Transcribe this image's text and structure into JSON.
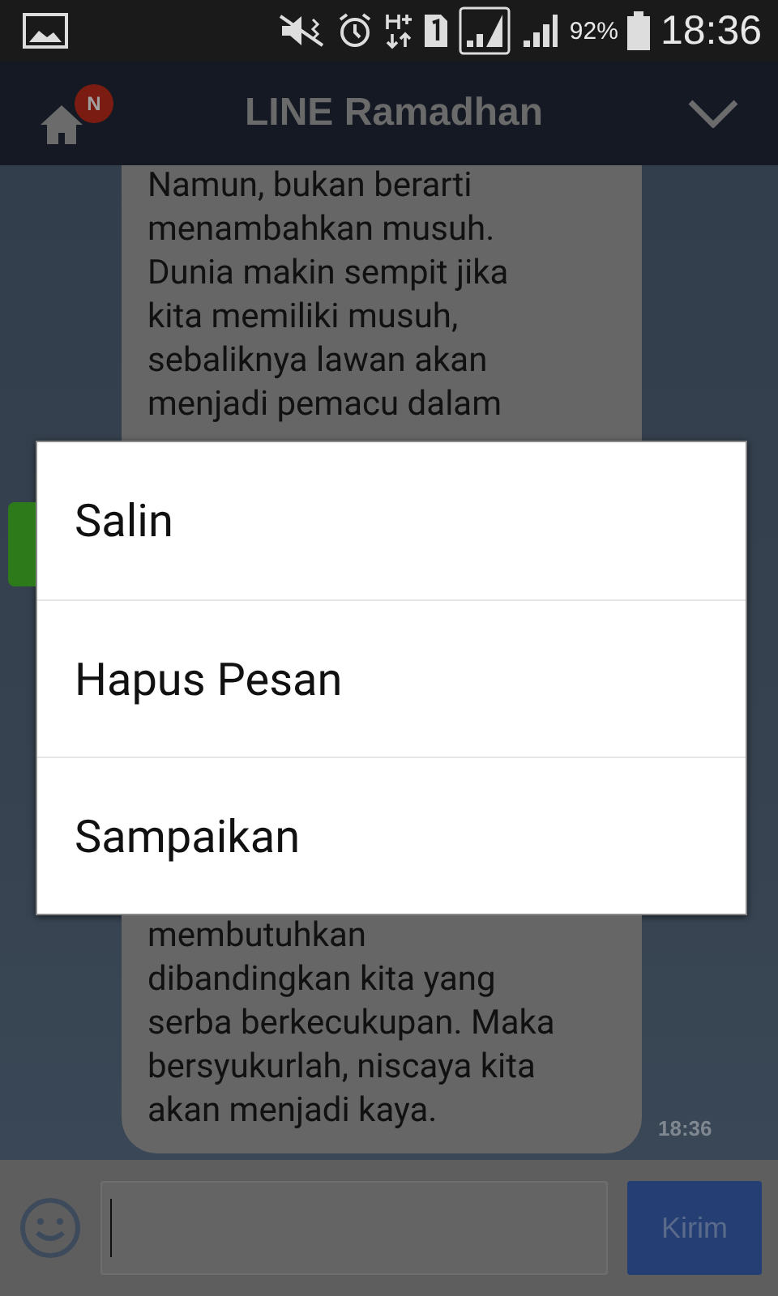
{
  "status_bar": {
    "battery": "92%",
    "time": "18:36"
  },
  "header": {
    "title": "LINE Ramadhan",
    "badge": "N"
  },
  "message": {
    "lines_above": [
      "Namun, bukan berarti",
      "menambahkan musuh.",
      "Dunia makin sempit jika",
      "kita memiliki musuh,",
      "sebaliknya lawan akan",
      "menjadi pemacu dalam"
    ],
    "lines_below": [
      "membutuhkan",
      "dibandingkan kita yang",
      "serba berkecukupan. Maka",
      "bersyukurlah, niscaya kita",
      "akan menjadi kaya."
    ],
    "time": "18:36"
  },
  "menu": {
    "items": [
      {
        "label": "Salin"
      },
      {
        "label": "Hapus Pesan"
      },
      {
        "label": "Sampaikan"
      }
    ]
  },
  "composer": {
    "send": "Kirim"
  }
}
